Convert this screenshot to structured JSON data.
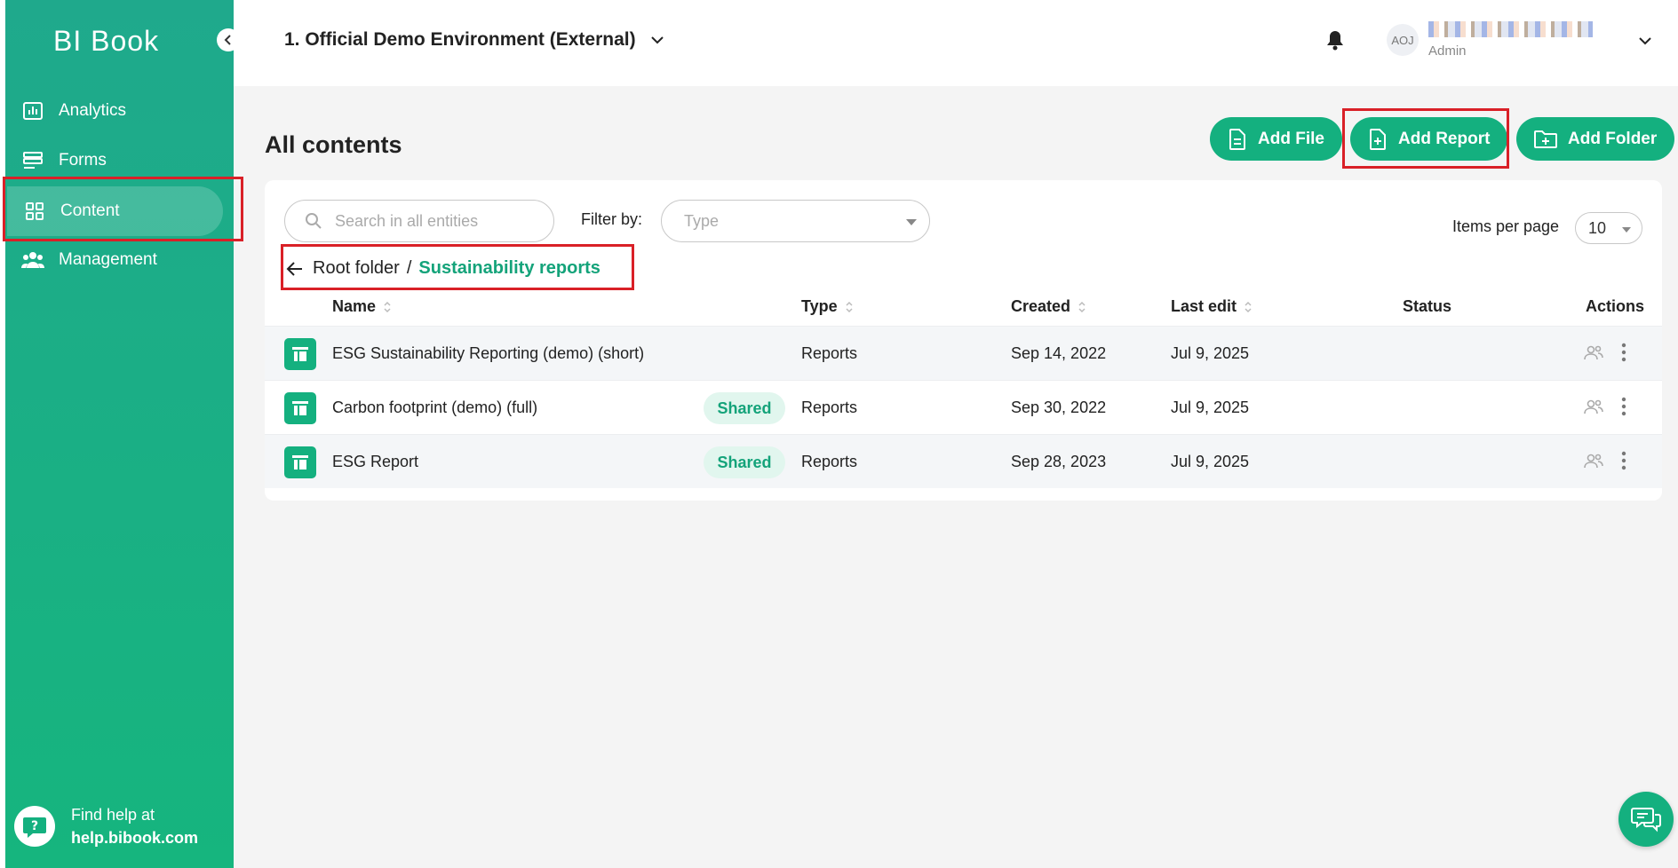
{
  "sidebar": {
    "logo": "BI Book",
    "items": [
      {
        "label": "Analytics",
        "icon": "analytics-icon"
      },
      {
        "label": "Forms",
        "icon": "forms-icon"
      },
      {
        "label": "Content",
        "icon": "content-grid-icon",
        "active": true
      },
      {
        "label": "Management",
        "icon": "people-icon"
      }
    ],
    "help": {
      "line1": "Find help at",
      "line2": "help.bibook.com"
    }
  },
  "header": {
    "environment": "1. Official Demo Environment (External)",
    "user": {
      "initials": "AOJ",
      "role": "Admin"
    }
  },
  "main": {
    "title": "All contents",
    "buttons": {
      "add_file": "Add File",
      "add_report": "Add Report",
      "add_folder": "Add Folder"
    },
    "search_placeholder": "Search in all entities",
    "filter_label": "Filter by:",
    "type_placeholder": "Type",
    "items_per_page_label": "Items per page",
    "items_per_page_value": "10",
    "breadcrumb": {
      "root": "Root folder",
      "separator": "/",
      "current": "Sustainability reports"
    },
    "columns": {
      "name": "Name",
      "type": "Type",
      "created": "Created",
      "last_edit": "Last edit",
      "status": "Status",
      "actions": "Actions"
    },
    "rows": [
      {
        "name": "ESG Sustainability Reporting (demo) (short)",
        "shared": "",
        "type": "Reports",
        "created": "Sep 14, 2022",
        "last_edit": "Jul 9, 2025"
      },
      {
        "name": "Carbon footprint (demo) (full)",
        "shared": "Shared",
        "type": "Reports",
        "created": "Sep 30, 2022",
        "last_edit": "Jul 9, 2025"
      },
      {
        "name": "ESG Report",
        "shared": "Shared",
        "type": "Reports",
        "created": "Sep 28, 2023",
        "last_edit": "Jul 9, 2025"
      }
    ]
  },
  "colors": {
    "brand": "#14b07f",
    "highlight": "#d92027"
  }
}
